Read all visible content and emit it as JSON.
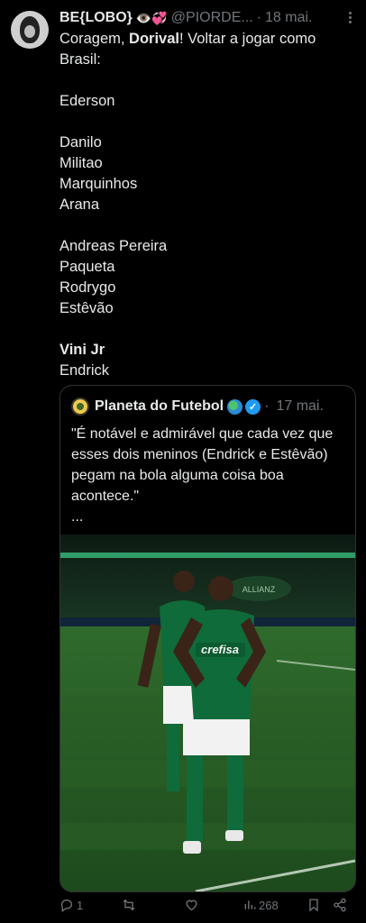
{
  "tweet": {
    "author_name": "BE{LOBO}",
    "author_emoji": "👁️💞",
    "handle": "@PIORDE...",
    "separator": "·",
    "time": "18 mai.",
    "line1_pre": "Coragem, ",
    "line1_bold": "Dorival",
    "line1_post": "! Voltar a jogar como",
    "line2": "Brasil:",
    "players": {
      "gk": "Ederson",
      "def1": "Danilo",
      "def2": "Militao",
      "def3": "Marquinhos",
      "def4": "Arana",
      "mid1": "Andreas Pereira",
      "mid2": "Paqueta",
      "mid3": "Rodrygo",
      "mid4": "Estêvão",
      "fwd1": "Vini Jr",
      "fwd2": "Endrick"
    }
  },
  "quote": {
    "author_name": "Planeta do Futebol",
    "separator": "·",
    "time": "17 mai.",
    "text": "\"É notável e admirável que cada vez que esses dois meninos (Endrick e Estêvão) pegam na bola alguma coisa boa acontece.\"",
    "ellipsis": "...",
    "image": {
      "shirt_sponsor": "crefisa",
      "stadium_text": "ALLIANZ"
    }
  },
  "actions": {
    "reply_count": "1",
    "retweet_count": "",
    "like_count": "",
    "views_count": "268"
  },
  "colors": {
    "background": "#000000",
    "text": "#e7e9ea",
    "muted": "#71767b",
    "border": "#2f3336",
    "verified": "#1d9bf0",
    "palmeiras_green": "#0f6b3a"
  }
}
